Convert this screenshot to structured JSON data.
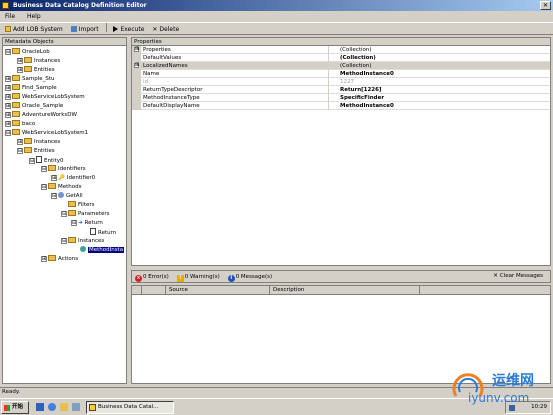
{
  "window": {
    "title": "Business Data Catalog Definition Editor",
    "close": "✕"
  },
  "menu": [
    "File",
    "Help"
  ],
  "toolbar": {
    "add": "Add LOB System",
    "import": "Import",
    "execute": "Execute",
    "delete": "Delete"
  },
  "metadata_pane": {
    "header": "Metadata Objects",
    "nodes": [
      {
        "label": "OracleLob",
        "expander": "⊟"
      },
      {
        "label": "Instances",
        "expander": "⊞"
      },
      {
        "label": "Entities",
        "expander": "⊞"
      },
      {
        "label": "Sample_Stu",
        "expander": "⊞"
      },
      {
        "label": "Find_Sample",
        "expander": "⊞"
      },
      {
        "label": "WebServiceLobSystem",
        "expander": "⊞"
      },
      {
        "label": "Oracle_Sample",
        "expander": "⊞"
      },
      {
        "label": "AdventureWorksDW",
        "expander": "⊞"
      },
      {
        "label": "baco",
        "expander": "⊞"
      },
      {
        "label": "WebServiceLobSystem1",
        "expander": "⊟"
      },
      {
        "label": "Instances",
        "expander": "⊞"
      },
      {
        "label": "Entities",
        "expander": "⊟"
      },
      {
        "label": "Entity0",
        "expander": "⊟"
      },
      {
        "label": "Identifiers",
        "expander": "⊟"
      },
      {
        "label": "Identifier0",
        "expander": "⊞"
      },
      {
        "label": "Methods",
        "expander": "⊟"
      },
      {
        "label": "GetAll",
        "expander": "⊟"
      },
      {
        "label": "Filters",
        "expander": ""
      },
      {
        "label": "Parameters",
        "expander": "⊟"
      },
      {
        "label": "Return",
        "expander": "⊟"
      },
      {
        "label": "Return",
        "expander": ""
      },
      {
        "label": "Instances",
        "expander": "⊟"
      },
      {
        "label": "MethodInsta",
        "expander": ""
      },
      {
        "label": "Actions",
        "expander": "⊞"
      }
    ]
  },
  "properties_pane": {
    "header": "Properties",
    "rows": [
      {
        "key": "Properties",
        "value": "(Collection)",
        "expander": "⊞"
      },
      {
        "key": "DefaultValues",
        "value": "(Collection)",
        "expander": ""
      },
      {
        "key": "LocalizedNames",
        "value": "(Collection)",
        "expander": "⊞"
      },
      {
        "key": "Name",
        "value": "MethodInstance0",
        "expander": ""
      },
      {
        "key": "Id",
        "value": "1227",
        "expander": ""
      },
      {
        "key": "ReturnTypeDescriptor",
        "value": "Return[1226]",
        "expander": ""
      },
      {
        "key": "MethodInstanceType",
        "value": "SpecificFinder",
        "expander": ""
      },
      {
        "key": "DefaultDisplayName",
        "value": "MethodInstance0",
        "expander": ""
      }
    ]
  },
  "error_list": {
    "errors": "0 Error(s)",
    "warnings": "0 Warning(s)",
    "messages": "0 Message(s)",
    "clear": "Clear Messages",
    "col_source": "Source",
    "col_description": "Description"
  },
  "status": "Ready.",
  "taskbar": {
    "start": "开始",
    "task": "Business Data Catal...",
    "clock": "10:29"
  },
  "watermark": {
    "line1": "运维网",
    "line2": "iyunv.com"
  },
  "colors": {
    "title_start": "#0a246a",
    "title_end": "#a6caf0",
    "selection": "#000080",
    "folder": "#e8c050"
  }
}
